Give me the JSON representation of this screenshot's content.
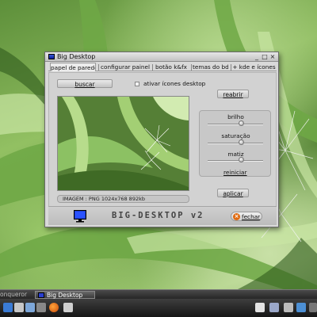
{
  "window": {
    "title": "Big Desktop",
    "tabs": [
      {
        "label": "papel de parede",
        "active": true
      },
      {
        "label": "configurar painel",
        "active": false
      },
      {
        "label": "botão k&fx",
        "active": false
      },
      {
        "label": "temas do bd",
        "active": false
      },
      {
        "label": "+ kde e ícones",
        "active": false
      }
    ]
  },
  "wallpaper_tab": {
    "browse_button": "buscar",
    "desktop_icons_checkbox": {
      "label": "ativar ícones desktop",
      "checked": false
    },
    "reopen_button": "reabrir",
    "image_info": "IMAGEM : PNG 1024x768 892kb",
    "adjustments": {
      "brightness_label": "brilho",
      "saturation_label": "saturação",
      "hue_label": "matiz",
      "brightness_level": 0.6,
      "saturation_level": 0.6,
      "hue_level": 0.6,
      "reset_button": "reiniciar"
    },
    "apply_button": "aplicar"
  },
  "footer": {
    "brand": "BIG-DESKTOP v2",
    "close_button": "fechar"
  },
  "taskbar": {
    "tasks": [
      "onqueror",
      "Big Desktop"
    ]
  },
  "colors": {
    "accent_blue": "#1f3fcf",
    "close_orange": "#e06a10"
  }
}
